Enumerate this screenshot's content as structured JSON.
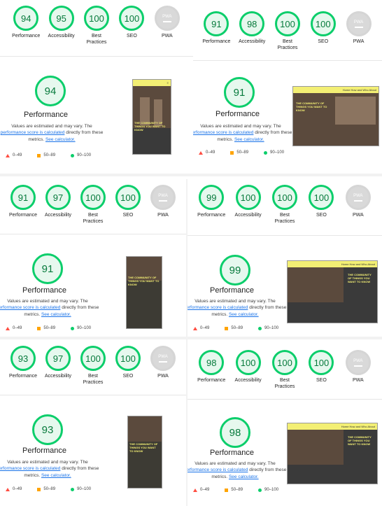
{
  "labels": {
    "performance": "Performance",
    "accessibility": "Accessibility",
    "best_practices_1": "Best",
    "best_practices_2": "Practices",
    "seo": "SEO",
    "pwa": "PWA",
    "pwa_icon": "PWA",
    "perf_title": "Performance",
    "desc_1": "Values are estimated and may vary. The",
    "desc_link": "performance score is calculated",
    "desc_2": "directly from",
    "desc_3": "these metrics.",
    "desc_calc": "See calculator.",
    "legend_fail": "0–49",
    "legend_avg": "50–89",
    "legend_pass": "90–100"
  },
  "reports": [
    {
      "performance": "94",
      "accessibility": "95",
      "best_practices": "100",
      "seo": "100",
      "perf_score": "94"
    },
    {
      "performance": "91",
      "accessibility": "98",
      "best_practices": "100",
      "seo": "100",
      "perf_score": "91"
    },
    {
      "performance": "91",
      "accessibility": "97",
      "best_practices": "100",
      "seo": "100",
      "perf_score": "91"
    },
    {
      "performance": "99",
      "accessibility": "100",
      "best_practices": "100",
      "seo": "100",
      "perf_score": "99"
    },
    {
      "performance": "93",
      "accessibility": "97",
      "best_practices": "100",
      "seo": "100",
      "perf_score": "93"
    },
    {
      "performance": "98",
      "accessibility": "100",
      "best_practices": "100",
      "seo": "100",
      "perf_score": "98"
    }
  ],
  "thumb_text": {
    "headline": "THE COMMUNITY OF THINGS YOU WANT TO KNOW",
    "nav": "Home  How and Who  About"
  },
  "colors": {
    "pass": "#0cce6b",
    "average": "#ffa400",
    "fail": "#ff4e42",
    "thumb_yellow": "#f3ef74"
  }
}
